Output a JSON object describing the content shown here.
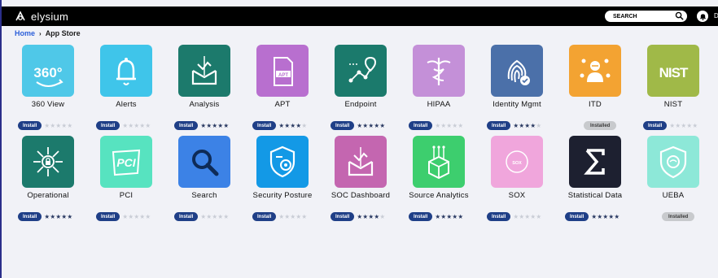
{
  "header": {
    "brand": "elysium",
    "search_placeholder": "SEARCH",
    "user_initial": "D"
  },
  "breadcrumb": {
    "home": "Home",
    "current": "App Store"
  },
  "labels": {
    "install": "Install",
    "installed": "Installed"
  },
  "apps": [
    {
      "name": "360 View",
      "color": "#4fc8e8",
      "icon": "360-icon",
      "installed": false,
      "rating": 0
    },
    {
      "name": "Alerts",
      "color": "#3fc5ea",
      "icon": "bell-icon",
      "installed": false,
      "rating": 0
    },
    {
      "name": "Analysis",
      "color": "#1c7a6c",
      "icon": "inbox-chart-icon",
      "installed": false,
      "rating": 5
    },
    {
      "name": "APT",
      "color": "#b86fcf",
      "icon": "apt-file-icon",
      "installed": false,
      "rating": 4
    },
    {
      "name": "Endpoint",
      "color": "#1b7a6c",
      "icon": "network-pin-icon",
      "installed": false,
      "rating": 5
    },
    {
      "name": "HIPAA",
      "color": "#c490d8",
      "icon": "caduceus-icon",
      "installed": false,
      "rating": 0
    },
    {
      "name": "Identity Mgmt",
      "color": "#4b70a9",
      "icon": "fingerprint-icon",
      "installed": false,
      "rating": 4
    },
    {
      "name": "ITD",
      "color": "#f3a332",
      "icon": "threat-person-icon",
      "installed": true,
      "rating": 0
    },
    {
      "name": "NIST",
      "color": "#a0b948",
      "icon": "nist-icon",
      "installed": false,
      "rating": 0
    },
    {
      "name": "Operational",
      "color": "#1c7a6c",
      "icon": "hub-lock-icon",
      "installed": false,
      "rating": 5
    },
    {
      "name": "PCI",
      "color": "#57e3c0",
      "icon": "pci-icon",
      "installed": false,
      "rating": 0
    },
    {
      "name": "Search",
      "color": "#3c82e6",
      "icon": "magnifier-icon",
      "installed": false,
      "rating": 0
    },
    {
      "name": "Security Posture",
      "color": "#1399e6",
      "icon": "shield-gear-icon",
      "installed": false,
      "rating": 0
    },
    {
      "name": "SOC Dashboard",
      "color": "#c466b0",
      "icon": "inbox-chart-icon",
      "installed": false,
      "rating": 4
    },
    {
      "name": "Source Analytics",
      "color": "#3dce6e",
      "icon": "source-box-icon",
      "installed": false,
      "rating": 5
    },
    {
      "name": "SOX",
      "color": "#f0a6dc",
      "icon": "sox-badge-icon",
      "installed": false,
      "rating": 0
    },
    {
      "name": "Statistical Data",
      "color": "#1d2030",
      "icon": "sigma-icon",
      "installed": false,
      "rating": 5
    },
    {
      "name": "UEBA",
      "color": "#8de8d8",
      "icon": "shield-brain-icon",
      "installed": true,
      "rating": 0
    }
  ]
}
